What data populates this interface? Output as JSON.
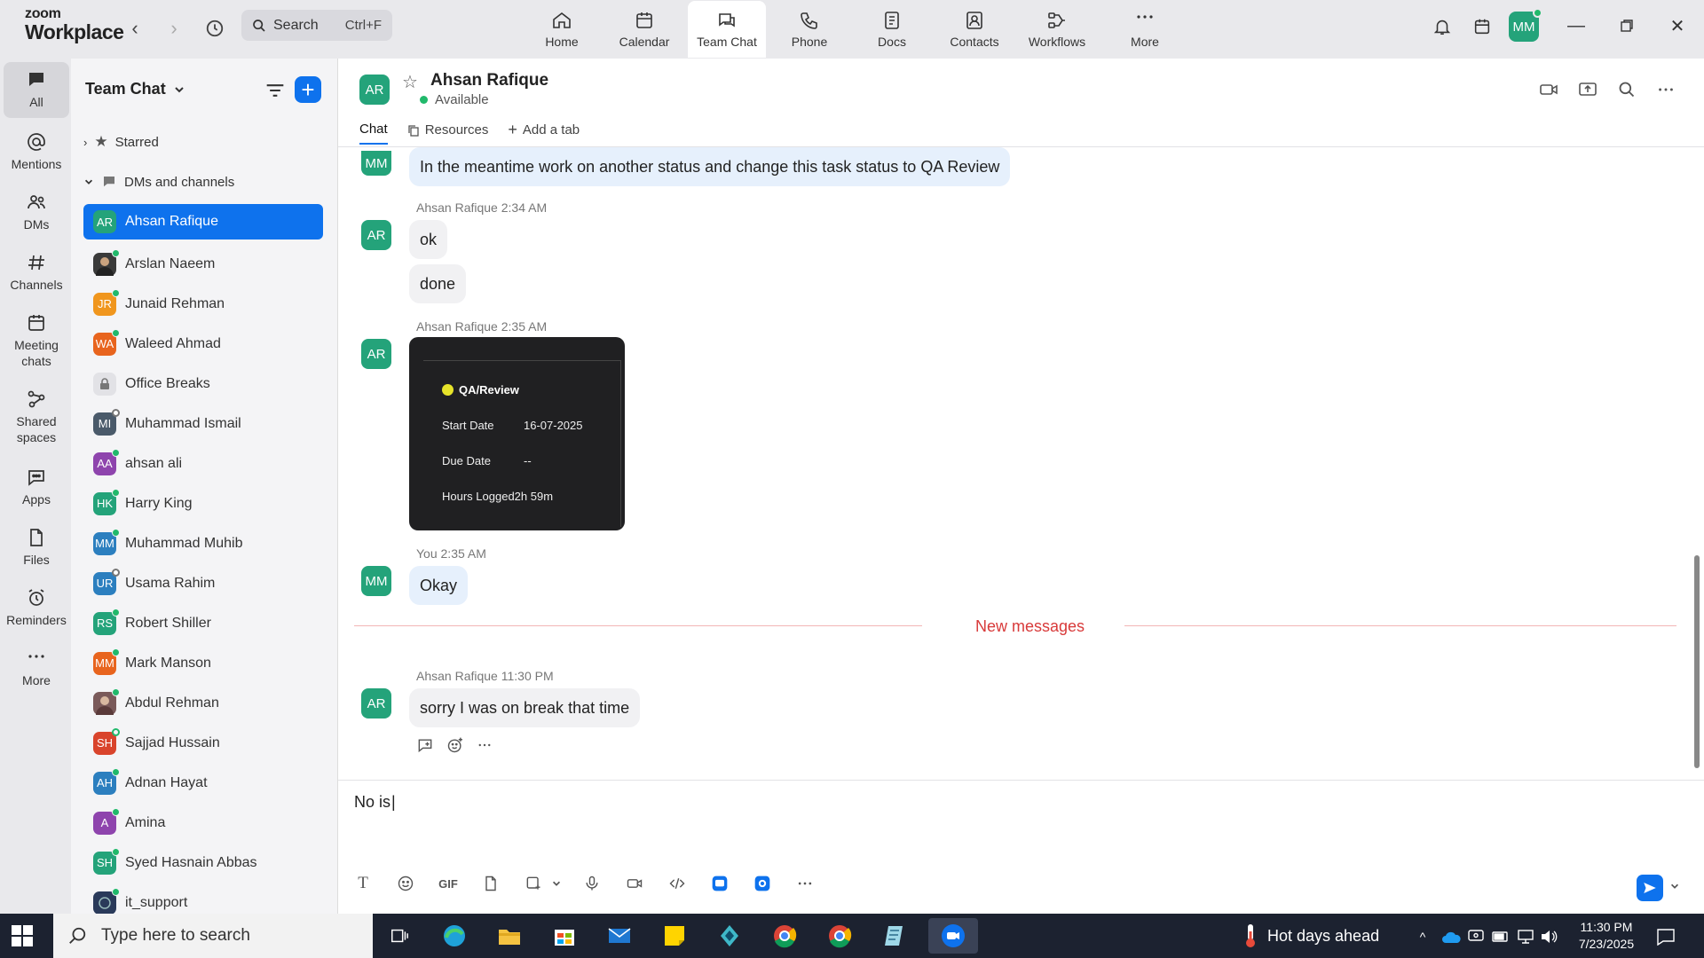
{
  "brand": {
    "line1": "zoom",
    "line2": "Workplace"
  },
  "search": {
    "label": "Search",
    "shortcut": "Ctrl+F"
  },
  "top_tabs": [
    {
      "label": "Home",
      "icon": "home-icon"
    },
    {
      "label": "Calendar",
      "icon": "calendar-icon"
    },
    {
      "label": "Team Chat",
      "icon": "chat-icon",
      "active": true
    },
    {
      "label": "Phone",
      "icon": "phone-icon"
    },
    {
      "label": "Docs",
      "icon": "docs-icon"
    },
    {
      "label": "Contacts",
      "icon": "contacts-icon"
    },
    {
      "label": "Workflows",
      "icon": "workflows-icon"
    },
    {
      "label": "More",
      "icon": "more-icon"
    }
  ],
  "user": {
    "initials": "MM"
  },
  "rail": [
    {
      "label": "All"
    },
    {
      "label": "Mentions"
    },
    {
      "label": "DMs"
    },
    {
      "label": "Channels"
    },
    {
      "label": "Meeting\nchats"
    },
    {
      "label": "Shared\nspaces"
    },
    {
      "label": "Apps"
    },
    {
      "label": "Files"
    },
    {
      "label": "Reminders"
    },
    {
      "label": "More"
    }
  ],
  "sidebar": {
    "title": "Team Chat",
    "starred": "Starred",
    "dms_section": "DMs and channels",
    "items": [
      {
        "initials": "AR",
        "name": "Ahsan Rafique",
        "color": "#24a37a",
        "selected": true
      },
      {
        "initials": "",
        "name": "Arslan Naeem",
        "color": "#3a3a3a",
        "status": "online"
      },
      {
        "initials": "JR",
        "name": "Junaid Rehman",
        "color": "#f0961e",
        "status": "online"
      },
      {
        "initials": "WA",
        "name": "Waleed Ahmad",
        "color": "#e8641e",
        "status": "online"
      },
      {
        "initials": "",
        "name": "Office Breaks",
        "color": "#e2e2e6",
        "lock": true
      },
      {
        "initials": "MI",
        "name": "Muhammad Ismail",
        "color": "#4a5a6a",
        "status": "away"
      },
      {
        "initials": "AA",
        "name": "ahsan ali",
        "color": "#8e44ad",
        "status": "online"
      },
      {
        "initials": "HK",
        "name": "Harry King",
        "color": "#24a37a",
        "status": "online"
      },
      {
        "initials": "MM",
        "name": "Muhammad Muhib",
        "color": "#2c7fbf",
        "status": "online"
      },
      {
        "initials": "UR",
        "name": "Usama Rahim",
        "color": "#2c7fbf",
        "status": "away"
      },
      {
        "initials": "RS",
        "name": "Robert Shiller",
        "color": "#24a37a",
        "status": "online"
      },
      {
        "initials": "MM",
        "name": "Mark Manson",
        "color": "#e8641e",
        "status": "online"
      },
      {
        "initials": "",
        "name": "Abdul Rehman",
        "color": "#7a5a5a",
        "status": "online"
      },
      {
        "initials": "SH",
        "name": "Sajjad Hussain",
        "color": "#d9442c",
        "status": "off"
      },
      {
        "initials": "AH",
        "name": "Adnan Hayat",
        "color": "#2c7fbf",
        "status": "online"
      },
      {
        "initials": "A",
        "name": "Amina",
        "color": "#8e44ad",
        "status": "online"
      },
      {
        "initials": "SH",
        "name": "Syed Hasnain Abbas",
        "color": "#24a37a",
        "status": "online"
      },
      {
        "initials": "",
        "name": "it_support",
        "color": "#2a3a5a",
        "status": "online"
      }
    ]
  },
  "chat": {
    "contact_initials": "AR",
    "contact_name": "Ahsan Rafique",
    "status": "Available",
    "tabs": [
      "Chat",
      "Resources",
      "Add a tab"
    ],
    "messages": {
      "m1_text": "In the meantime work on another status and change this task status to QA Review",
      "m2_meta_name": "Ahsan Rafique",
      "m2_meta_time": "2:34 AM",
      "m2_text1": "ok",
      "m2_text2": "done",
      "m3_meta_name": "Ahsan Rafique",
      "m3_meta_time": "2:35 AM",
      "card": {
        "status": "QA/Review",
        "start_label": "Start Date",
        "start_value": "16-07-2025",
        "due_label": "Due Date",
        "due_value": "--",
        "hours_label": "Hours Logged",
        "hours_value": "2h 59m"
      },
      "m4_meta_name": "You",
      "m4_meta_time": "2:35 AM",
      "m4_text": "Okay",
      "new_messages": "New messages",
      "m5_meta_name": "Ahsan Rafique",
      "m5_meta_time": "11:30 PM",
      "m5_text": "sorry I was on break that time"
    },
    "composer_value": "No is",
    "gif_label": "GIF"
  },
  "taskbar": {
    "search_placeholder": "Type here to search",
    "weather": "Hot days ahead",
    "time": "11:30 PM",
    "date": "7/23/2025"
  }
}
